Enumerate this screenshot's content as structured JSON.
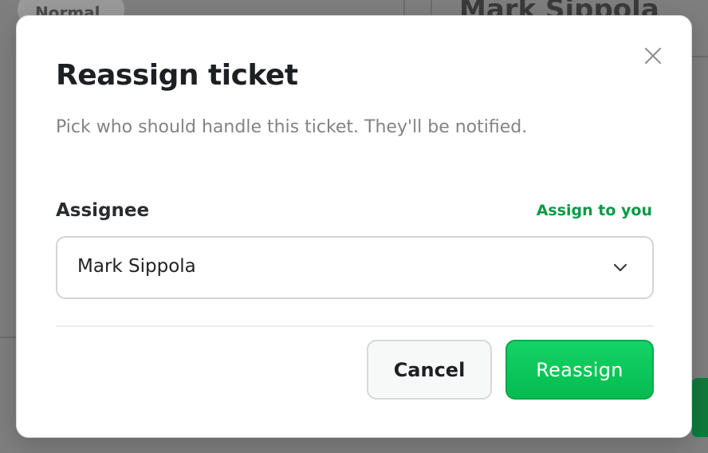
{
  "background": {
    "chip_label": "Normal",
    "heading": "Mark Sippola"
  },
  "dialog": {
    "title": "Reassign ticket",
    "description": "Pick who should handle this ticket. They'll be notified.",
    "close_icon": "close-icon"
  },
  "assignee": {
    "label": "Assignee",
    "assign_to_you": "Assign to you",
    "selected_value": "Mark Sippola",
    "chevron_icon": "chevron-down-icon"
  },
  "actions": {
    "cancel_label": "Cancel",
    "reassign_label": "Reassign"
  },
  "colors": {
    "accent_green": "#05bb4f",
    "link_green": "#0a9a45",
    "title_text": "#1d1f22",
    "muted_text": "#828385"
  }
}
